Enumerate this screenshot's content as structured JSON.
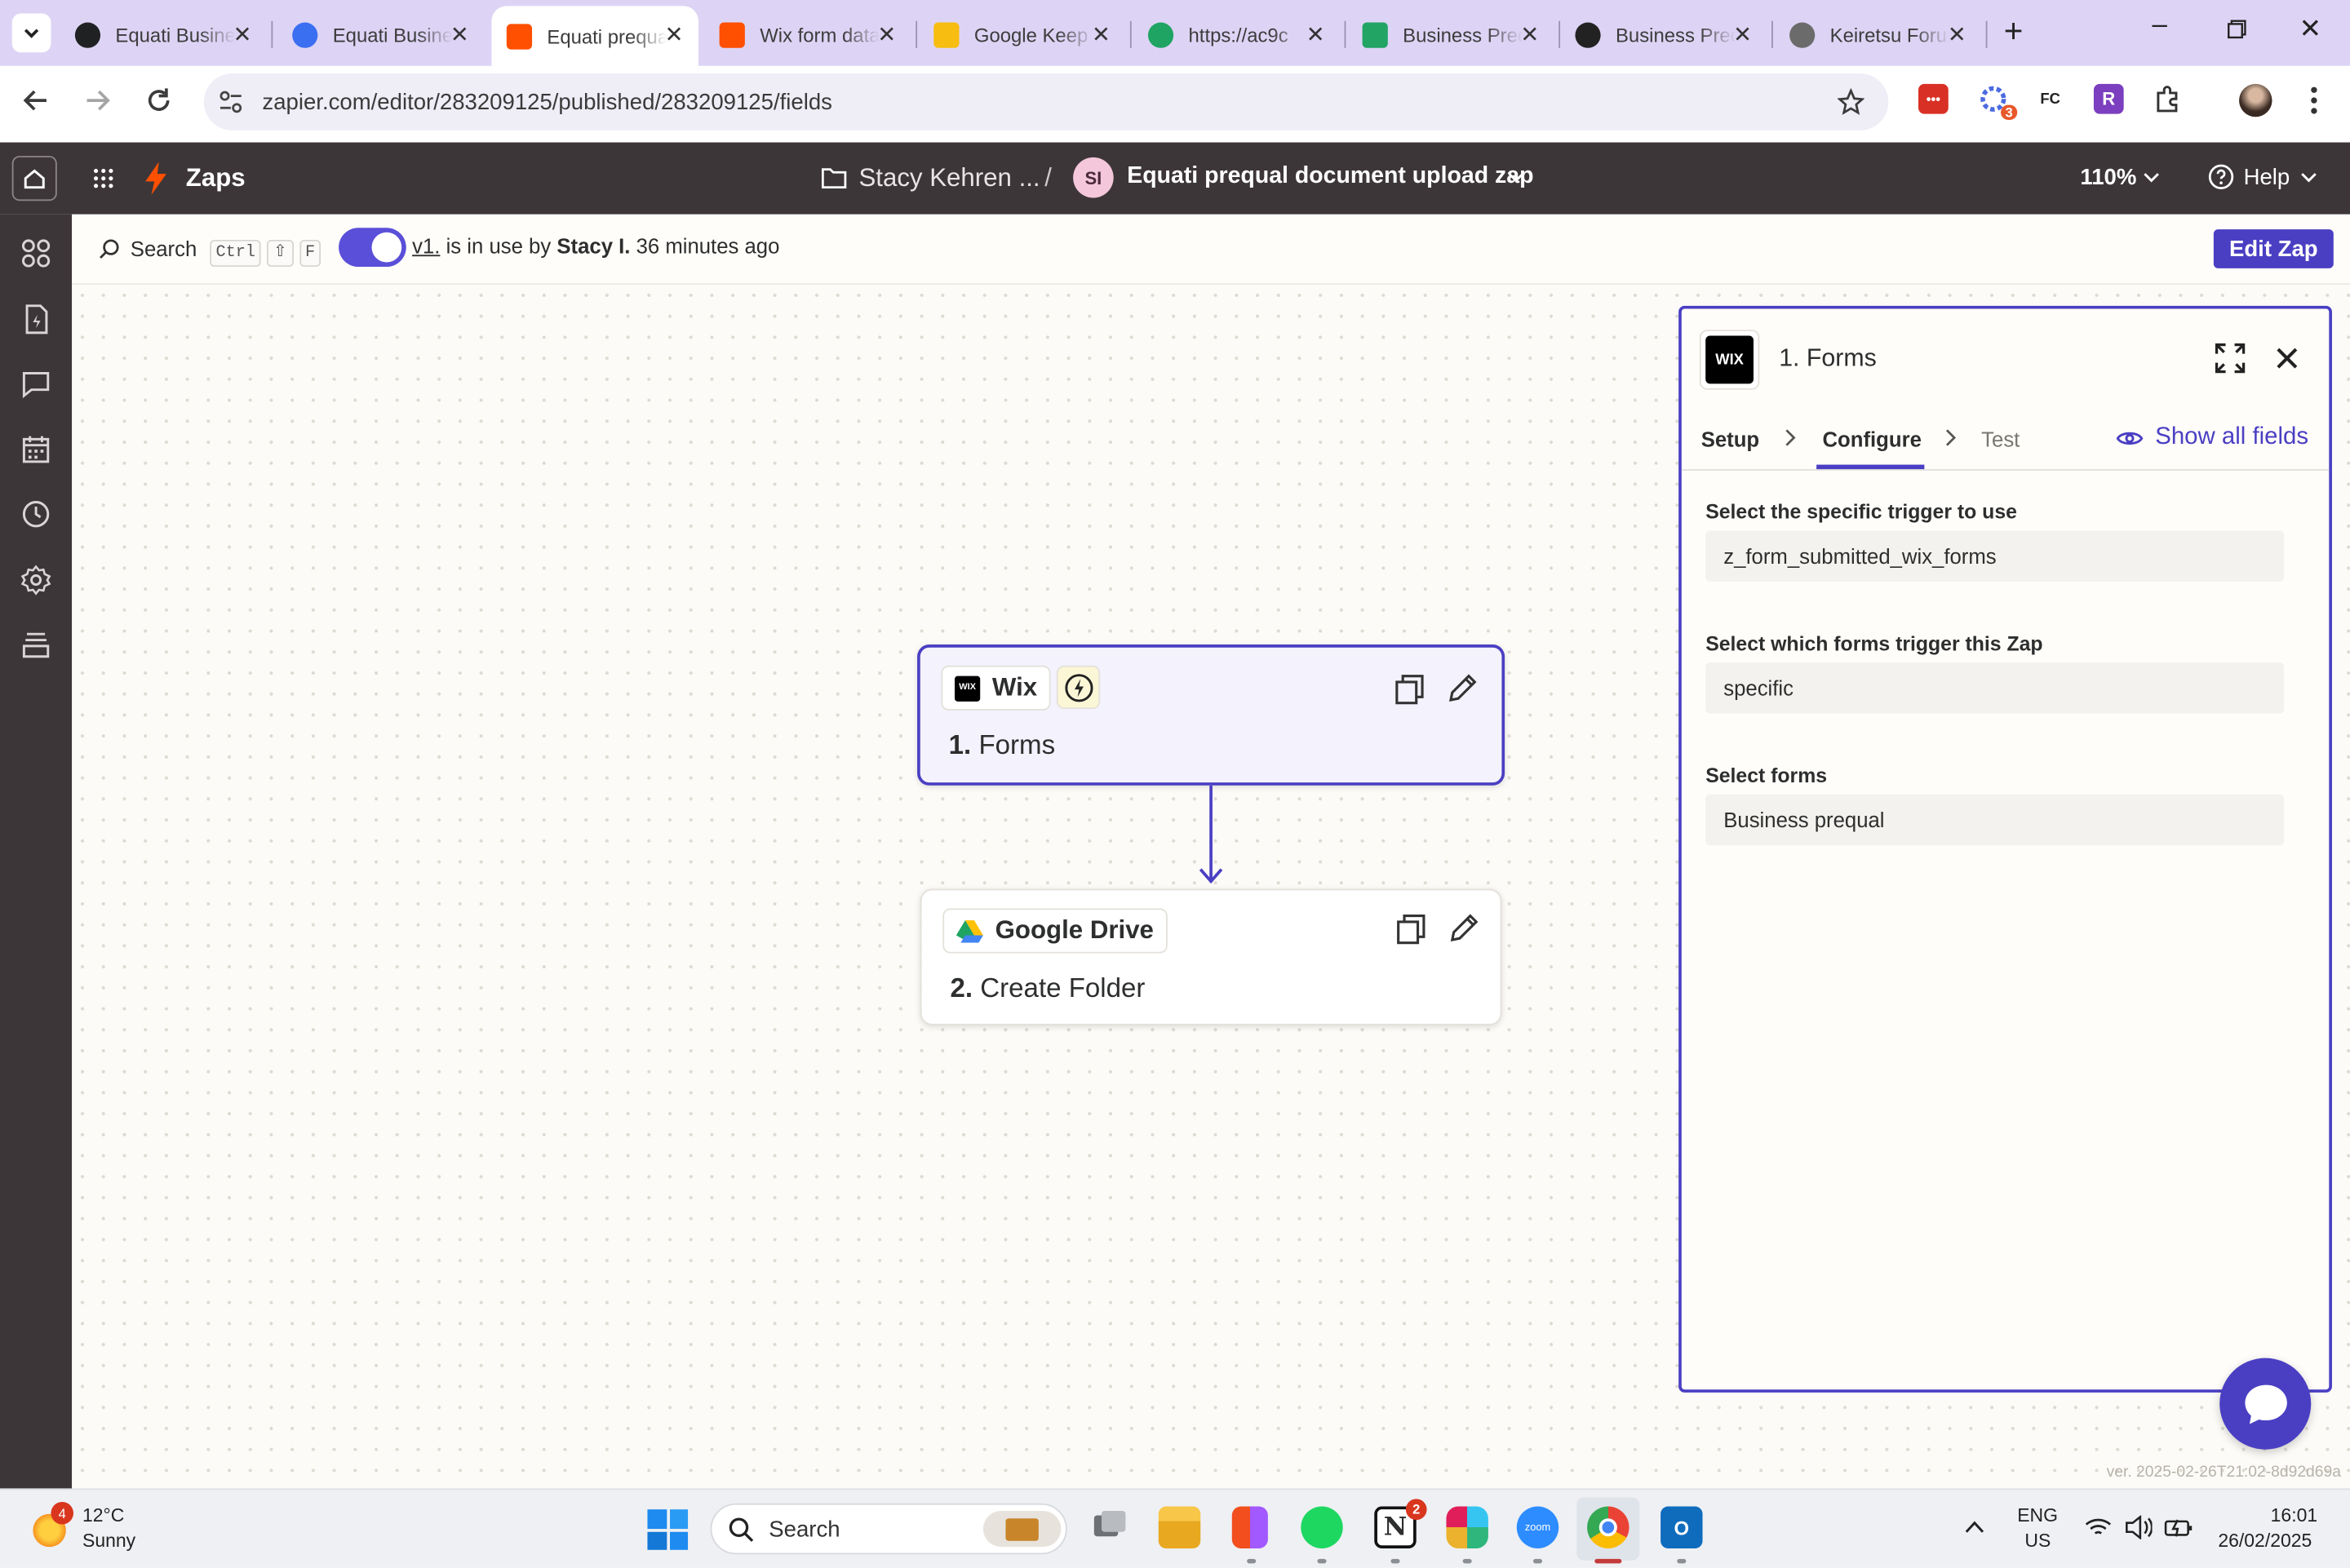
{
  "browser": {
    "tabs": [
      {
        "title": "Equati Business",
        "icon": "openai-icon",
        "color": "#202123"
      },
      {
        "title": "Equati Business",
        "icon": "c-icon",
        "color": "#3b6ff2"
      },
      {
        "title": "Equati prequal",
        "icon": "zapier-icon",
        "color": "#ff4f00"
      },
      {
        "title": "Wix form data",
        "icon": "zapier-icon",
        "color": "#ff4f00"
      },
      {
        "title": "Google Keep",
        "icon": "keep-icon",
        "color": "#f7bd10"
      },
      {
        "title": "https://ac9c",
        "icon": "drive-icon",
        "color": "#1fa463"
      },
      {
        "title": "Business Prequal",
        "icon": "sheets-icon",
        "color": "#21a464"
      },
      {
        "title": "Business Prequal",
        "icon": "typeform-icon",
        "color": "#222222"
      },
      {
        "title": "Keiretsu Forum",
        "icon": "globe-icon",
        "color": "#6b6b6b"
      }
    ],
    "new_tab": "+",
    "url": "zapier.com/editor/283209125/published/283209125/fields",
    "extensions": [
      {
        "label": "•••",
        "color": "#d93025"
      },
      {
        "label": "3",
        "color": "#6a5acd"
      },
      {
        "label": "FC",
        "color": "#ffffff"
      },
      {
        "label": "R",
        "color": "#7b3fbf"
      }
    ]
  },
  "zapier": {
    "app_name": "Zaps",
    "breadcrumb_folder": "Stacy Kehren ...",
    "breadcrumb_sep": "/",
    "owner_initials": "SI",
    "zap_name": "Equati prequal document upload zap",
    "zoom": "110%",
    "help": "Help",
    "search_label": "Search",
    "shortcut_keys": [
      "Ctrl",
      "⇧",
      "F"
    ],
    "version_link": "v1.",
    "status_prefix": " is in use by ",
    "status_user": "Stacy I.",
    "status_suffix": " 36 minutes ago",
    "edit_button": "Edit Zap",
    "version_footer": "ver. 2025-02-26T21:02-8d92d69a"
  },
  "steps": [
    {
      "app": "Wix",
      "logo": "WIX",
      "number": "1.",
      "title": "Forms"
    },
    {
      "app": "Google Drive",
      "number": "2.",
      "title": "Create Folder"
    }
  ],
  "panel": {
    "logo": "WIX",
    "title": "1. Forms",
    "tabs": [
      "Setup",
      "Configure",
      "Test"
    ],
    "show_all": "Show all fields",
    "fields": [
      {
        "label": "Select the specific trigger to use",
        "value": "z_form_submitted_wix_forms"
      },
      {
        "label": "Select which forms trigger this Zap",
        "value": "specific"
      },
      {
        "label": "Select forms",
        "value": "Business prequal"
      }
    ]
  },
  "taskbar": {
    "weather_badge": "4",
    "temperature": "12°C",
    "condition": "Sunny",
    "search": "Search",
    "lang": "ENG",
    "region": "US",
    "time": "16:01",
    "date": "26/02/2025",
    "notion_badge": "2"
  }
}
